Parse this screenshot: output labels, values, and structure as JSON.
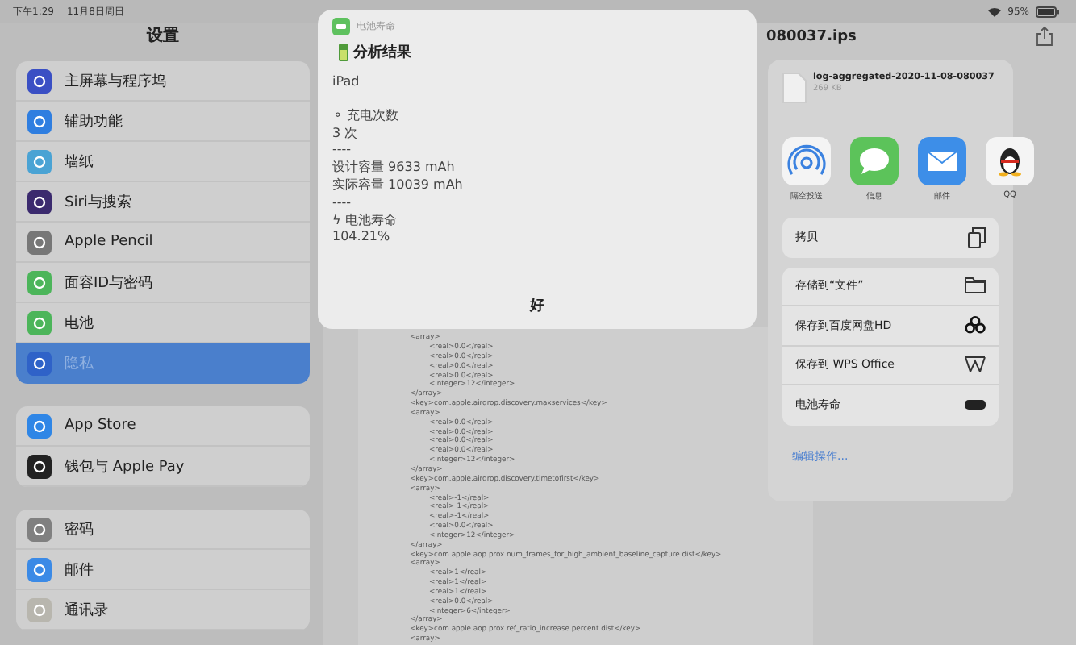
{
  "status_bar": {
    "time": "下午1:29",
    "date": "11月8日周日",
    "battery": "95%"
  },
  "sidebar": {
    "title": "设置",
    "groups": [
      {
        "items": [
          {
            "label": "主屏幕与程序坞",
            "color": "#3a4fc4",
            "selected": false
          },
          {
            "label": "辅助功能",
            "color": "#2f7ee0",
            "selected": false
          },
          {
            "label": "墙纸",
            "color": "#4aa3d4",
            "selected": false
          },
          {
            "label": "Siri与搜索",
            "color": "#3b2a6e",
            "selected": false
          },
          {
            "label": "Apple Pencil",
            "color": "#777777",
            "selected": false
          },
          {
            "label": "面容ID与密码",
            "color": "#4cb55a",
            "selected": false
          },
          {
            "label": "电池",
            "color": "#4cb55a",
            "selected": false
          },
          {
            "label": "隐私",
            "color": "#2f62c8",
            "selected": true
          }
        ]
      },
      {
        "items": [
          {
            "label": "App Store",
            "color": "#2f86e6",
            "selected": false
          },
          {
            "label": "钱包与 Apple Pay",
            "color": "#222222",
            "selected": false
          }
        ]
      },
      {
        "items": [
          {
            "label": "密码",
            "color": "#808080",
            "selected": false
          },
          {
            "label": "邮件",
            "color": "#3b8ae6",
            "selected": false
          },
          {
            "label": "通讯录",
            "color": "#b8b6ae",
            "selected": false
          }
        ]
      }
    ]
  },
  "document": {
    "title": "080037.ips",
    "lines": [
      {
        "text": "<array>",
        "indent": false
      },
      {
        "text": "<real>0.0</real>",
        "indent": true
      },
      {
        "text": "<real>0.0</real>",
        "indent": true
      },
      {
        "text": "<real>0.0</real>",
        "indent": true
      },
      {
        "text": "<real>0.0</real>",
        "indent": true
      },
      {
        "text": "<integer>12</integer>",
        "indent": true
      },
      {
        "text": "</array>",
        "indent": false
      },
      {
        "text": "<key>com.apple.airdrop.discovery.maxservices</key>",
        "indent": false
      },
      {
        "text": "<array>",
        "indent": false
      },
      {
        "text": "<real>0.0</real>",
        "indent": true
      },
      {
        "text": "<real>0.0</real>",
        "indent": true
      },
      {
        "text": "<real>0.0</real>",
        "indent": true
      },
      {
        "text": "<real>0.0</real>",
        "indent": true
      },
      {
        "text": "<integer>12</integer>",
        "indent": true
      },
      {
        "text": "</array>",
        "indent": false
      },
      {
        "text": "<key>com.apple.airdrop.discovery.timetofirst</key>",
        "indent": false
      },
      {
        "text": "<array>",
        "indent": false
      },
      {
        "text": "<real>-1</real>",
        "indent": true
      },
      {
        "text": "<real>-1</real>",
        "indent": true
      },
      {
        "text": "<real>-1</real>",
        "indent": true
      },
      {
        "text": "<real>0.0</real>",
        "indent": true
      },
      {
        "text": "<integer>12</integer>",
        "indent": true
      },
      {
        "text": "</array>",
        "indent": false
      },
      {
        "text": "<key>com.apple.aop.prox.num_frames_for_high_ambient_baseline_capture.dist</key>",
        "indent": false
      },
      {
        "text": "<array>",
        "indent": false
      },
      {
        "text": "<real>1</real>",
        "indent": true
      },
      {
        "text": "<real>1</real>",
        "indent": true
      },
      {
        "text": "<real>1</real>",
        "indent": true
      },
      {
        "text": "<real>0.0</real>",
        "indent": true
      },
      {
        "text": "<integer>6</integer>",
        "indent": true
      },
      {
        "text": "</array>",
        "indent": false
      },
      {
        "text": "<key>com.apple.aop.prox.ref_ratio_increase.percent.dist</key>",
        "indent": false
      },
      {
        "text": "<array>",
        "indent": false
      }
    ]
  },
  "alert": {
    "app_name": "电池寿命",
    "title": "分析结果",
    "sections": [
      [
        "iPad"
      ],
      [
        "⚬ 充电次数",
        "3 次",
        "----",
        "设计容量 9633 mAh",
        "实际容量 10039 mAh",
        "----",
        "ϟ 电池寿命",
        "104.21%"
      ]
    ],
    "button": "好"
  },
  "share_sheet": {
    "file_name": "log-aggregated-2020-11-08-080037",
    "file_size": "269 KB",
    "apps": [
      {
        "label": "隔空投送",
        "kind": "airdrop"
      },
      {
        "label": "信息",
        "kind": "messages"
      },
      {
        "label": "邮件",
        "kind": "mail"
      },
      {
        "label": "QQ",
        "kind": "qq"
      }
    ],
    "action_groups": [
      [
        {
          "label": "拷贝",
          "kind": "copy"
        }
      ],
      [
        {
          "label": "存储到“文件”",
          "kind": "folder"
        },
        {
          "label": "保存到百度网盘HD",
          "kind": "cloud"
        },
        {
          "label": "保存到 WPS Office",
          "kind": "wps"
        },
        {
          "label": "电池寿命",
          "kind": "battery"
        }
      ]
    ],
    "edit_link": "编辑操作..."
  }
}
